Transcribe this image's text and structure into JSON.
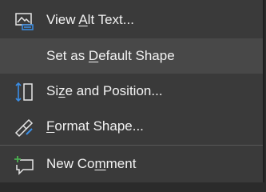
{
  "menu": {
    "items": [
      {
        "icon": "alt-text-icon",
        "pre": "View ",
        "key": "A",
        "post": "lt Text..."
      },
      {
        "icon": "",
        "pre": "Set as ",
        "key": "D",
        "post": "efault Shape"
      },
      {
        "icon": "size-position-icon",
        "pre": "Si",
        "key": "z",
        "post": "e and Position..."
      },
      {
        "icon": "format-shape-icon",
        "pre": "",
        "key": "F",
        "post": "ormat Shape..."
      },
      {
        "icon": "new-comment-icon",
        "pre": "New Co",
        "key": "m",
        "post": "ment"
      }
    ]
  },
  "colors": {
    "menu_bg": "#3a3a3a",
    "hover_bg": "#484848",
    "text": "#f2f2f2",
    "accent_blue": "#3a8ee6",
    "accent_green": "#4caf50"
  }
}
